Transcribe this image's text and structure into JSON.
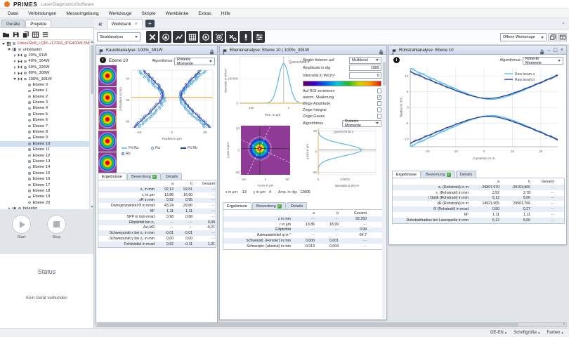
{
  "window": {
    "brand": "PRIMES",
    "app_title": "LaserDiagnosticsSoftware"
  },
  "menu": {
    "items": [
      "Datei",
      "Verbindungen",
      "Messumgebung",
      "Werkzeuge",
      "Skripte",
      "Werkbänke",
      "Extras",
      "Hilfe"
    ]
  },
  "sidebar": {
    "tabs": [
      "Geräte",
      "Projekte"
    ],
    "active_tab": "Projekte",
    "toolbar_icons": [
      "folder",
      "save",
      "copy",
      "table",
      "list"
    ],
    "tree": {
      "root": "FokusShift_LQM-+17064_IPG400W-5M",
      "group": "unbelastet",
      "measurements": [
        {
          "label": "20%_61W",
          "expanded": false
        },
        {
          "label": "40%_164W",
          "expanded": false
        },
        {
          "label": "60%_226W",
          "expanded": false
        },
        {
          "label": "80%_308W",
          "expanded": false
        },
        {
          "label": "100%_391W",
          "expanded": true
        }
      ],
      "planes": [
        "Ebene 0",
        "Ebene 1",
        "Ebene 2",
        "Ebene 3",
        "Ebene 4",
        "Ebene 5",
        "Ebene 6",
        "Ebene 7",
        "Ebene 8",
        "Ebene 9",
        "Ebene 10",
        "Ebene 11",
        "Ebene 12",
        "Ebene 13",
        "Ebene 14",
        "Ebene 15",
        "Ebene 16",
        "Ebene 17",
        "Ebene 18",
        "Ebene 19",
        "Ebene 20"
      ],
      "selected_plane": "Ebene 10",
      "tail_group": "belastet"
    },
    "start_label": "Start",
    "stop_label": "Stop",
    "status_title": "Status",
    "status_message": "Kein Gerät verbunden"
  },
  "workbench": {
    "collapse_icon": "«",
    "tab_label": "Werkbank",
    "analysis_select": "Strahlanalyse",
    "tools": [
      "caustic",
      "beam",
      "curve",
      "grid",
      "target",
      "target-frame",
      "x-zero",
      "bar",
      "sliders"
    ],
    "open_tools_label": "Offene Werkzeuge",
    "open_tool_icons": [
      "stack",
      "window"
    ]
  },
  "panels": {
    "caustic": {
      "title": "Kaustikanalyse: 100%_391W",
      "plane_label": "Ebene 10",
      "algorithm_label": "Algorithmus:",
      "algorithm_value": "Rotierte Momente",
      "legend": [
        "Fit Ra",
        "Ra",
        "Fit Rb",
        "Rb"
      ],
      "tabs": [
        "Ergebnisse",
        "Bewertung",
        "Details"
      ],
      "table": {
        "columns": [
          "a",
          "b",
          "Gesamt"
        ],
        "rows": [
          {
            "label": "z₀ in mm",
            "a": "92,12",
            "b": "92,51",
            "g": "---"
          },
          {
            "label": "r₀ in µm",
            "a": "13,86",
            "b": "16,90",
            "g": "---"
          },
          {
            "label": "zR in mm",
            "a": "0,92",
            "b": "0,95",
            "g": "---"
          },
          {
            "label": "Divergenzwinkel Θ in mrad",
            "a": "43,24",
            "b": "29,86",
            "g": "---"
          },
          {
            "label": "M²",
            "a": "1,11",
            "b": "1,11",
            "g": "---"
          },
          {
            "label": "SPP in mm·mrad",
            "a": "0,98",
            "b": "0,98",
            "g": "---"
          },
          {
            "label": "Elliptizität bei z₀",
            "a": "---",
            "b": "---",
            "g": "0,99"
          },
          {
            "label": "Δz₀/zR",
            "a": "---",
            "b": "---",
            "g": "-0,21"
          },
          {
            "label": "Schwerpunkt x bei z₀ in mm",
            "a": "-0,01",
            "b": "-0,01",
            "g": "---"
          },
          {
            "label": "Schwerpunkt y bei z₀ in mm",
            "a": "0,00",
            "b": "0,00",
            "g": "---"
          },
          {
            "label": "Fehlwinkel in mrad",
            "a": "0,62",
            "b": "-0,11",
            "g": "1,21"
          }
        ]
      }
    },
    "plane": {
      "title": "Ebenenanalyse: Ebene 10 | 100%_391W",
      "controls": {
        "regler_label": "Regler fixieren auf",
        "regler_value": "Multilevel",
        "amplitude_label": "Amplitude in dig",
        "amplitude_value": "1005",
        "intensity_label": "Intensität in W/cm²",
        "intensity_value": "0",
        "checkboxes": [
          {
            "label": "Auf ROI zentrieren",
            "checked": false
          },
          {
            "label": "autom. Skalierung",
            "checked": true
          },
          {
            "label": "Zeige Amplitude",
            "checked": false
          },
          {
            "label": "Zeige Integral",
            "checked": false
          },
          {
            "label": "Zeige Gauss",
            "checked": false
          }
        ],
        "algorithm_label": "Algorithmus",
        "algorithm_value": "Rotierte Momente"
      },
      "cursor": {
        "x_label": "x in µm:",
        "x_value": "-13",
        "y_label": "y in µm:",
        "y_value": "4",
        "amp_label": "Amp. in dig:",
        "amp_value": "12605"
      },
      "tabs": [
        "Ergebnisse",
        "Bewertung",
        "Details"
      ],
      "table": {
        "columns": [
          "a",
          "b",
          "Gesamt"
        ],
        "rows": [
          {
            "label": "z in mm",
            "a": "---",
            "b": "---",
            "g": "92,250"
          },
          {
            "label": "r in µm",
            "a": "13,86",
            "b": "18,99",
            "g": "---"
          },
          {
            "label": "Elliptizität",
            "a": "---",
            "b": "---",
            "g": "0,99"
          },
          {
            "label": "Azimutalwinkel φ in °",
            "a": "---",
            "b": "---",
            "g": "-64,7"
          },
          {
            "label": "Schwerpkt. (Fenster) in mm",
            "a": "0,000",
            "b": "0,001",
            "g": "---"
          },
          {
            "label": "Schwerpkt. (absolut) in mm",
            "a": "-0,013",
            "b": "0,004",
            "g": "---"
          }
        ]
      }
    },
    "raw": {
      "title": "Rohstrahlanalyse: Ebene 10",
      "algorithm_label": "Algorithmus:",
      "algorithm_value": "Rotierte Momente",
      "tabs": [
        "Ergebnisse",
        "Bewertung",
        "Details"
      ],
      "table": {
        "columns": [
          "a",
          "b",
          "Gesamt"
        ],
        "rows": [
          {
            "label": "z₀ (Rohstrahl) in m",
            "a": "-29897,970",
            "b": "-20153,866",
            "g": "---"
          },
          {
            "label": "r₀ (Rohstrahl) in mm",
            "a": "2,52",
            "b": "2,78",
            "g": "---"
          },
          {
            "label": "r Optik (Rohstrahl) in mm",
            "a": "5,12",
            "b": "5,06",
            "g": "---"
          },
          {
            "label": "zR (Rohstrahl) in m",
            "a": "14921,905",
            "b": "29501,766",
            "g": "---"
          },
          {
            "label": "Θ (Rohstrahl) in mrad",
            "a": "0,50",
            "b": "0,27",
            "g": "---"
          },
          {
            "label": "M²",
            "a": "1,11",
            "b": "1,11",
            "g": "---"
          },
          {
            "label": "Rohstrahlradius bei Laserquelle in mm",
            "a": "5,12",
            "b": "5,06",
            "g": "---"
          }
        ]
      }
    }
  },
  "chart_data": [
    {
      "id": "caustic",
      "type": "scatter",
      "xlabel": "Radius in µm",
      "ylabel": "z-Position in mm",
      "xticks": [
        -60,
        0,
        60
      ],
      "yticks": [
        94,
        92,
        90
      ],
      "xlim": [
        -74,
        74
      ],
      "zlim": [
        89.4,
        94.8
      ],
      "focus_z": 92.25,
      "focus_color": "#f2c178",
      "series": [
        {
          "name": "Ra",
          "fit_name": "Fit Ra",
          "r0_um": 14,
          "zr_mm": 0.62,
          "z0_mm": 92.12,
          "fit_color": "#79c9ef",
          "point_color": "#4aa3d8"
        },
        {
          "name": "Rb",
          "fit_name": "Fit Rb",
          "r0_um": 17,
          "zr_mm": 0.78,
          "z0_mm": 92.51,
          "fit_color": "#24439e",
          "point_color": "#3558c0"
        }
      ]
    },
    {
      "id": "profile_x",
      "type": "line",
      "title": "Querschnitt x",
      "xlabel": "Pos. in µm",
      "ylabel": "Intensität in W/cm²",
      "xticks": [
        -100,
        0
      ],
      "yticks": [
        100000,
        0
      ],
      "xlim": [
        -130,
        45
      ],
      "peak": 162000,
      "center_um": -13,
      "sigma_um": 14,
      "line_color": "#58b8e8",
      "zero_line_color": "#f2c178"
    },
    {
      "id": "beam2d",
      "type": "heatmap",
      "xlabel": "x-pos in µm",
      "ylabel": "y-pos in µm",
      "xticks": [
        -50,
        0,
        50
      ],
      "yticks": [
        50,
        0,
        -50
      ],
      "center_um": [
        -13,
        4
      ],
      "azimuth_deg": -64.7,
      "bg_color": "#8e3a96"
    },
    {
      "id": "profile_y",
      "type": "line",
      "title": "Querschnitt y",
      "xlabel": "Intensität in W/cm²",
      "ylabel": "y-pos in µm",
      "xticks": [
        0,
        100000
      ],
      "yticks": [
        50,
        0,
        -50
      ],
      "peak": 162000,
      "center_um": 4,
      "sigma_um": 14,
      "line_color": "#58b8e8",
      "zero_line_color": "#f2c178"
    },
    {
      "id": "rawbeam",
      "type": "line",
      "xlabel": "z-position in m",
      "ylabel": "Radius in mm",
      "xticks": [
        -20,
        -10,
        0,
        10,
        20
      ],
      "yticks": [
        10,
        5,
        0,
        -5,
        -10
      ],
      "xlim": [
        -26,
        26
      ],
      "series": [
        {
          "name": "Raw beam a",
          "r0_mm": 2.55,
          "theta": 0.425,
          "z0_m": 2.5,
          "color": "#55c2ea"
        },
        {
          "name": "Raw beam b",
          "r0_mm": 2.85,
          "theta": 0.4,
          "z0_m": 1.5,
          "color": "#2b3f9e"
        }
      ]
    }
  ],
  "statusbar": {
    "items": [
      "DE-EN",
      "Schriftgröße",
      "Farben"
    ]
  }
}
